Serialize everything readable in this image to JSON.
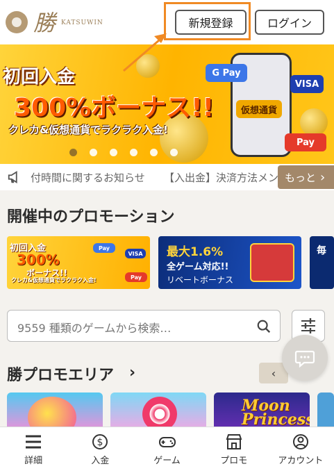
{
  "header": {
    "logo_kanji": "勝",
    "logo_text": "KATSUWIN",
    "register_label": "新規登録",
    "login_label": "ログイン"
  },
  "banner": {
    "line1": "初回入金",
    "line2": "300%ボーナス!!",
    "line3": "クレカ&仮想通貨でラクラク入金!",
    "pay_badges": [
      "G Pay",
      "VISA",
      "仮想通貨",
      "Pay"
    ],
    "slides_total": 6,
    "slide_active": 1
  },
  "ticker": {
    "text1": "付時間に関するお知らせ",
    "text2": "【入出金】決済方法メン",
    "more_label": "もっと"
  },
  "promotions": {
    "title": "開催中のプロモーション",
    "cards": [
      {
        "line1": "初回入金",
        "line2": "300%",
        "line3": "ボーナス!!",
        "line4": "クレカ&仮想通貨でラクラク入金!"
      },
      {
        "line1a": "最大",
        "line1b": "1.6%",
        "line2": "全ゲーム対応!!",
        "line3": "リベートボーナス"
      },
      {
        "edge_text": "毎"
      }
    ]
  },
  "search": {
    "placeholder": "9559 種類のゲームから検索…"
  },
  "katsu_area": {
    "title": "勝プロモエリア",
    "chevron": "›",
    "prev": "‹",
    "game3_title": "Moon Princess"
  },
  "bottom_nav": [
    {
      "label": "詳細",
      "icon": "menu-icon"
    },
    {
      "label": "入金",
      "icon": "dollar-icon"
    },
    {
      "label": "ゲーム",
      "icon": "gamepad-icon"
    },
    {
      "label": "プロモ",
      "icon": "store-icon"
    },
    {
      "label": "アカウント",
      "icon": "account-icon"
    }
  ],
  "colors": {
    "accent": "#a3886a",
    "highlight": "#f08a24",
    "banner": "#ffc61a"
  }
}
